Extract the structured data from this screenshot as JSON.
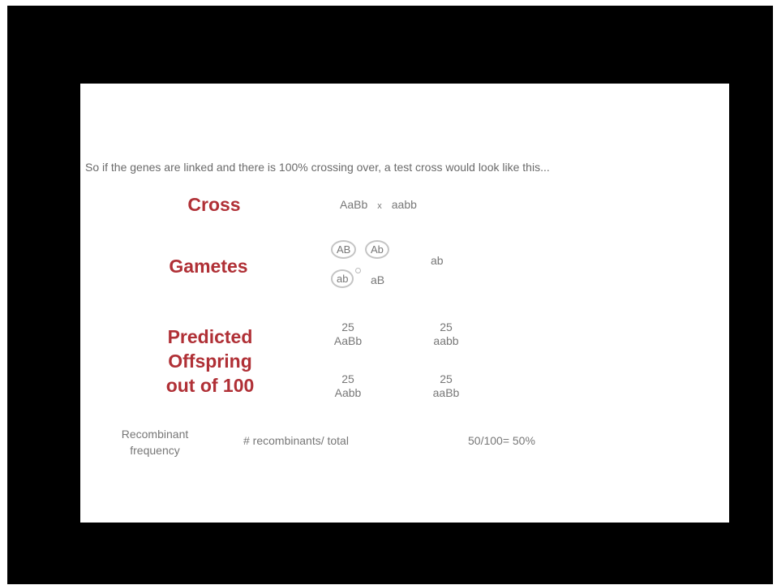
{
  "slide": {
    "intro": "So if the genes are linked and there is 100% crossing over, a test cross would look like this...",
    "cross": {
      "label": "Cross",
      "parent1": "AaBb",
      "times": "x",
      "parent2": "aabb"
    },
    "gametes": {
      "label": "Gametes",
      "list": [
        "AB",
        "Ab",
        "ab",
        "aB"
      ],
      "other": "ab"
    },
    "offspring": {
      "label_line1": "Predicted",
      "label_line2": "Offspring",
      "label_line3": "out of 100",
      "cells": [
        {
          "count": "25",
          "genotype": "AaBb"
        },
        {
          "count": "25",
          "genotype": "aabb"
        },
        {
          "count": "25",
          "genotype": "Aabb"
        },
        {
          "count": "25",
          "genotype": "aaBb"
        }
      ]
    },
    "recombinant": {
      "label_line1": "Recombinant",
      "label_line2": "frequency",
      "formula": "# recombinants/ total",
      "value": "50/100= 50%"
    }
  }
}
